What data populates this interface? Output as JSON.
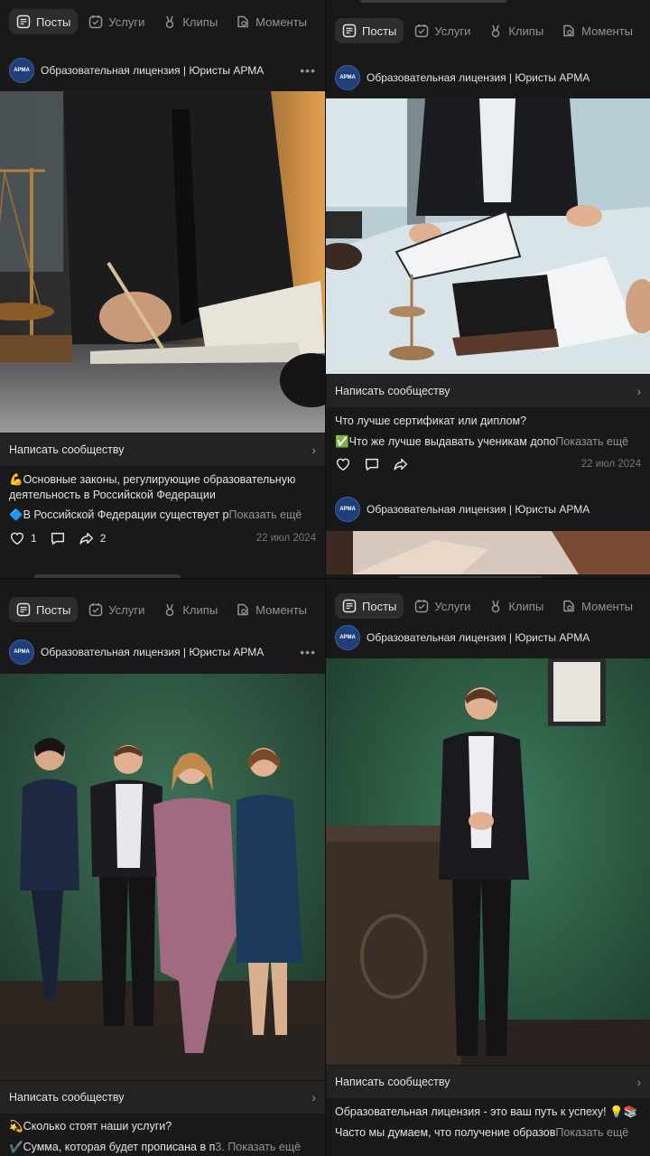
{
  "tabs": {
    "posts": "Посты",
    "services": "Услуги",
    "clips": "Клипы",
    "moments": "Моменты"
  },
  "group": {
    "name": "Образовательная лицензия | Юристы АРМА",
    "avatar_text": "АРМА"
  },
  "write_label": "Написать сообществу",
  "show_more": "Показать ещё",
  "posts": [
    {
      "line1": "💪Основные законы, регулирующие образовательную деятельность в Российской Федерации",
      "line2": "🔷В Российской Федерации существует р",
      "likes": "1",
      "shares": "2",
      "date": "22 июл 2024"
    },
    {
      "line1": "Что лучше сертификат или диплом?",
      "line2": "✅Что же лучше выдавать ученикам допо",
      "date": "22 июл 2024"
    },
    {
      "line1": "💫Сколько стоят наши услуги?",
      "line2": "✔️Сумма, которая будет прописана в п",
      "line2_fade": "3.",
      "date": ""
    },
    {
      "line1": "Образовательная лицензия - это ваш путь к успеху! 💡📚",
      "line2": "Часто мы думаем, что получение образов",
      "date": ""
    }
  ],
  "colors": {
    "background": "#19191a",
    "card": "#232324",
    "text": "#e1e3e6",
    "secondary": "#909499",
    "avatar": "#1f3f7a",
    "wall_green": "#2f5a45"
  }
}
